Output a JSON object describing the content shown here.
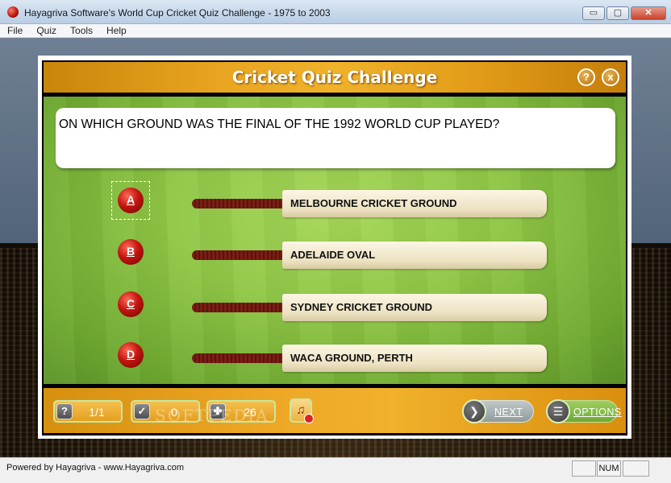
{
  "window": {
    "title": "Hayagriva Software's World Cup Cricket Quiz Challenge - 1975 to 2003",
    "buttons": {
      "minimize": "▭",
      "maximize": "▢",
      "close": "✕"
    }
  },
  "menu": [
    "File",
    "Quiz",
    "Tools",
    "Help"
  ],
  "header": {
    "title": "Cricket Quiz Challenge",
    "help_label": "?",
    "close_label": "x"
  },
  "question": "ON WHICH GROUND WAS THE FINAL OF THE 1992 WORLD CUP PLAYED?",
  "options": [
    {
      "letter": "A",
      "text": "MELBOURNE CRICKET GROUND"
    },
    {
      "letter": "B",
      "text": "ADELAIDE OVAL"
    },
    {
      "letter": "C",
      "text": "SYDNEY CRICKET GROUND"
    },
    {
      "letter": "D",
      "text": "WACA GROUND, PERTH"
    }
  ],
  "footer": {
    "question_counter": {
      "icon": "question-icon",
      "glyph": "?",
      "value": "1/1"
    },
    "correct_count": {
      "icon": "checkmark-icon",
      "glyph": "✓",
      "value": "0"
    },
    "timer": {
      "icon": "clover-icon",
      "glyph": "✤",
      "value": "26"
    },
    "sound": {
      "icon": "music-note-muted-icon",
      "glyph": "♫"
    },
    "next": {
      "label": "NEXT",
      "glyph": "❯"
    },
    "options": {
      "label": "OPTIONS",
      "glyph": "☰"
    }
  },
  "watermark": "SOFTPEDIA",
  "statusbar": {
    "text": "Powered by Hayagriva - www.Hayagriva.com",
    "panels": [
      "",
      "NUM",
      ""
    ]
  }
}
